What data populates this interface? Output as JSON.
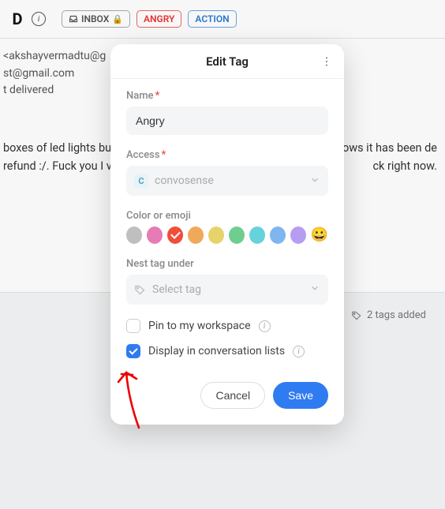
{
  "bg": {
    "bold_letter": "D",
    "pills": {
      "inbox": "INBOX",
      "angry": "ANGRY",
      "action": "ACTION"
    },
    "from_line": "<akshayvermadtu@g",
    "to_line": "st@gmail.com",
    "status": "t delivered",
    "body_l1": "boxes of led lights bu",
    "body_r1": "shows it has been de",
    "body_l2": "refund :/. Fuck you I v",
    "body_r2": "ck right now.",
    "tags_added": "2 tags added"
  },
  "modal": {
    "title": "Edit Tag",
    "name_label": "Name",
    "name_value": "Angry",
    "access_label": "Access",
    "access_value": "convosense",
    "access_badge": "C",
    "color_label": "Color or emoji",
    "colors": [
      {
        "hex": "#bfbfbf",
        "selected": false
      },
      {
        "hex": "#e77bb5",
        "selected": false
      },
      {
        "hex": "#ef4e3a",
        "selected": true
      },
      {
        "hex": "#f0a95a",
        "selected": false
      },
      {
        "hex": "#e8d36a",
        "selected": false
      },
      {
        "hex": "#6fce8f",
        "selected": false
      },
      {
        "hex": "#66d2db",
        "selected": false
      },
      {
        "hex": "#7fb6f0",
        "selected": false
      },
      {
        "hex": "#b79df0",
        "selected": false
      }
    ],
    "emoji": "😀",
    "nest_label": "Nest tag under",
    "nest_placeholder": "Select tag",
    "pin_label": "Pin to my workspace",
    "pin_checked": false,
    "display_label": "Display in conversation lists",
    "display_checked": true,
    "cancel": "Cancel",
    "save": "Save"
  }
}
